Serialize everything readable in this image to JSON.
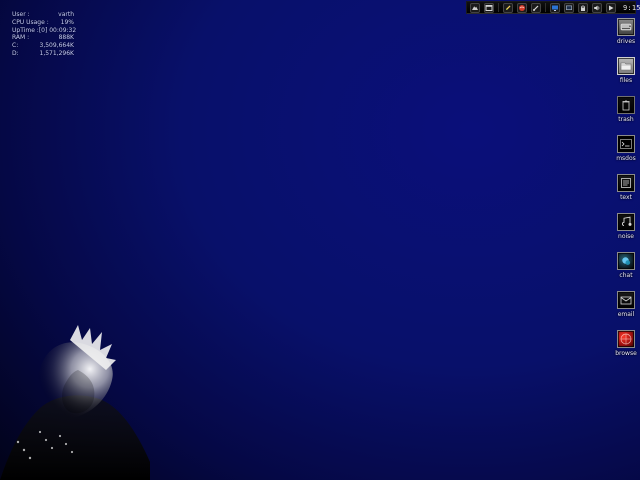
{
  "sysmon": {
    "user_label": "User :",
    "user_value": "varth",
    "cpu_label": "CPU Usage :",
    "cpu_value": "19%",
    "uptime_label": "UpTime :",
    "uptime_value": "[0] 00:09:32",
    "ram_label": "RAM :",
    "ram_value": "888K",
    "c_label": "C:",
    "c_value": "3,509,664K",
    "d_label": "D:",
    "d_value": "1,571,296K"
  },
  "taskbar": {
    "clock": "9:15"
  },
  "desktop_icons": [
    {
      "label": "drives",
      "icon": "drives-icon"
    },
    {
      "label": "files",
      "icon": "folder-icon"
    },
    {
      "label": "trash",
      "icon": "trash-icon"
    },
    {
      "label": "msdos",
      "icon": "terminal-icon"
    },
    {
      "label": "text",
      "icon": "text-icon"
    },
    {
      "label": "noise",
      "icon": "music-icon"
    },
    {
      "label": "chat",
      "icon": "chat-icon"
    },
    {
      "label": "email",
      "icon": "mail-icon"
    },
    {
      "label": "browse",
      "icon": "browser-icon"
    }
  ]
}
